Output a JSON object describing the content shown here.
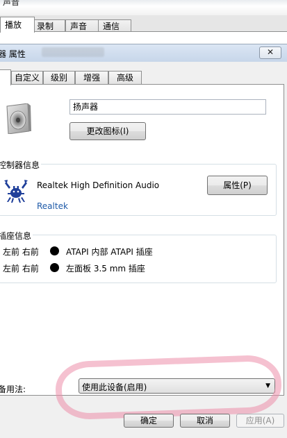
{
  "background_window": {
    "title": "声音",
    "tabs": [
      "播放",
      "录制",
      "声音",
      "通信"
    ]
  },
  "dialog": {
    "title": "器 属性",
    "close_label": "✕",
    "tabs": [
      "",
      "自定义",
      "级别",
      "增强",
      "高级"
    ],
    "device_name": "扬声器",
    "change_icon_label": "更改图标(I)",
    "controller": {
      "group_label": "控制器信息",
      "name": "Realtek High Definition Audio",
      "vendor": "Realtek",
      "properties_label": "属性(P)"
    },
    "jack": {
      "group_label": "插座信息",
      "rows": [
        {
          "channels": "左前 右前",
          "description": "ATAPI 内部 ATAPI 插座"
        },
        {
          "channels": "左前 右前",
          "description": "左面板 3.5 mm 插座"
        }
      ]
    },
    "usage": {
      "label": "备用法:",
      "selected": "使用此设备(启用)"
    },
    "buttons": {
      "ok": "确定",
      "cancel": "取消",
      "apply": "应用(A)"
    },
    "colors": {
      "highlight": "#ed8eaa",
      "link": "#1e5aa8",
      "title_bar": "#c7d6ea"
    }
  }
}
